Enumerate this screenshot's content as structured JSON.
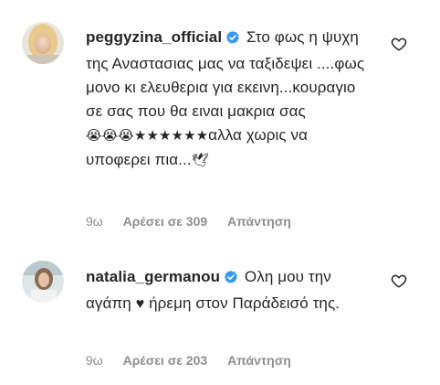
{
  "comments": [
    {
      "username": "peggyzina_official",
      "verified": true,
      "text": "Στο φως η ψυχη της Αναστασιας μας να ταξιδεψει ....φως μονο κι ελευθερια για εκεινη...κουραγιο σε σας που θα ειναι μακρια σας",
      "text_tail": "αλλα χωρις να υποφερει πια...",
      "emoji_prefix": "😭😭😭★★★★★★",
      "emoji_suffix": "🕊",
      "time": "9ω",
      "likes": "Αρέσει σε 309",
      "reply": "Απάντηση"
    },
    {
      "username": "natalia_germanou",
      "verified": true,
      "text_before_heart": "Ολη μου την αγάπη",
      "heart": "♥",
      "text_after_heart": "ήρεμη στον Παράδεισό της.",
      "time": "9ω",
      "likes": "Αρέσει σε 203",
      "reply": "Απάντηση"
    }
  ],
  "colors": {
    "text": "#262626",
    "meta": "#8e8e8e",
    "verified": "#3897f0"
  },
  "icons": {
    "verified": "verified-badge-icon",
    "like": "heart-outline-icon"
  }
}
